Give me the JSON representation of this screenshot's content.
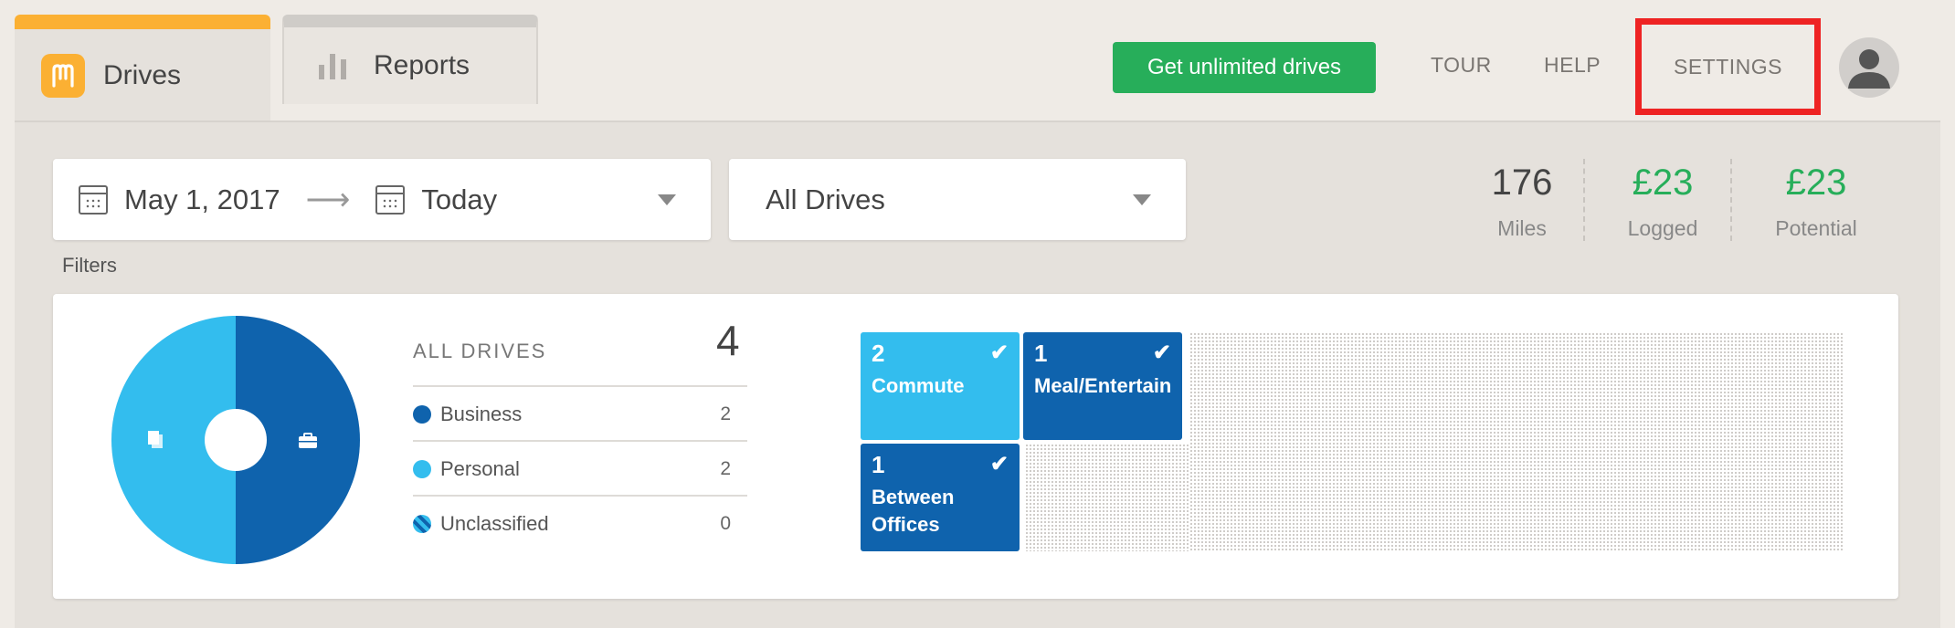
{
  "tabs": {
    "drives": {
      "label": "Drives",
      "color": "#fbb033"
    },
    "reports": {
      "label": "Reports"
    }
  },
  "header": {
    "cta_label": "Get unlimited drives",
    "tour_label": "TOUR",
    "help_label": "HELP",
    "settings_label": "SETTINGS",
    "highlight_color": "#ee2323"
  },
  "filters": {
    "start_date": "May 1, 2017",
    "arrow": "⟶",
    "end_date": "Today",
    "drive_type": "All Drives",
    "label": "Filters"
  },
  "stats": {
    "miles": {
      "value": "176",
      "label": "Miles"
    },
    "logged": {
      "value": "£23",
      "label": "Logged"
    },
    "potential": {
      "value": "£23",
      "label": "Potential"
    }
  },
  "summary": {
    "heading": "ALL DRIVES",
    "total": "4",
    "legend": [
      {
        "label": "Business",
        "count": "2",
        "color": "#0f63ad"
      },
      {
        "label": "Personal",
        "count": "2",
        "color": "#33bdee"
      },
      {
        "label": "Unclassified",
        "count": "0",
        "color": "#0f63ad"
      }
    ],
    "pie": {
      "business_fraction": 0.5,
      "personal_fraction": 0.5
    },
    "tiles": [
      {
        "count": "2",
        "name": "Commute",
        "color": "#33bdee"
      },
      {
        "count": "1",
        "name": "Meal/Entertain",
        "color": "#0f63ad"
      },
      {
        "count": "1",
        "name": "Between Offices",
        "color": "#0f63ad"
      }
    ]
  }
}
